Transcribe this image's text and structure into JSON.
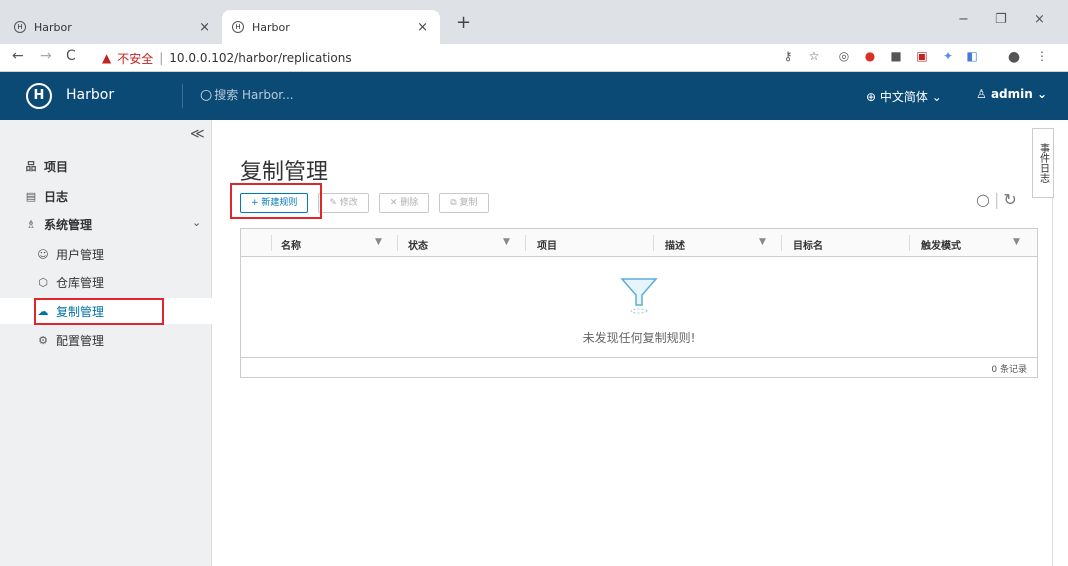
{
  "browser": {
    "tabs": [
      {
        "title": "Harbor",
        "close": "×"
      },
      {
        "title": "Harbor",
        "close": "×"
      }
    ],
    "new_tab": "+",
    "window": {
      "minimize": "−",
      "restore": "❐",
      "close": "×"
    },
    "nav": {
      "back": "←",
      "forward": "→",
      "reload": "C"
    },
    "warning_icon": "▲",
    "insecure_label": "不安全",
    "separator": "|",
    "url": "10.0.0.102/harbor/replications"
  },
  "header": {
    "brand": "Harbor",
    "search_placeholder": "搜索 Harbor...",
    "language": "中文简体",
    "user": "admin"
  },
  "sidebar": {
    "collapse": "≪",
    "items": [
      {
        "label": "项目",
        "icon": "projects-icon"
      },
      {
        "label": "日志",
        "icon": "logs-icon"
      },
      {
        "label": "系统管理",
        "icon": "admin-icon"
      }
    ],
    "sub_items": [
      {
        "label": "用户管理"
      },
      {
        "label": "仓库管理"
      },
      {
        "label": "复制管理"
      },
      {
        "label": "配置管理"
      }
    ]
  },
  "main": {
    "title": "复制管理",
    "toolbar": {
      "new_rule": "+ 新建规则",
      "edit": "✎ 修改",
      "delete": "✕ 删除",
      "copy": "⧉ 复制"
    },
    "columns": [
      "名称",
      "状态",
      "项目",
      "描述",
      "目标名",
      "触发模式"
    ],
    "empty_text": "未发现任何复制规则!",
    "footer": "0 条记录"
  },
  "side_panel": {
    "label": "事件日志"
  },
  "colors": {
    "header_bg": "#0c4a76",
    "accent": "#0079b8",
    "highlight": "#e0262c"
  }
}
